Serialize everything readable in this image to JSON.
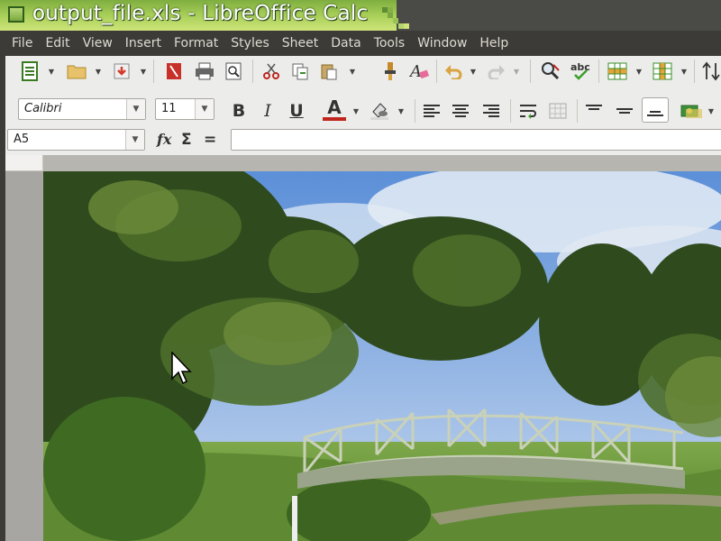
{
  "window": {
    "title": "output_file.xls - LibreOffice Calc"
  },
  "menubar": [
    "File",
    "Edit",
    "View",
    "Insert",
    "Format",
    "Styles",
    "Sheet",
    "Data",
    "Tools",
    "Window",
    "Help"
  ],
  "toolbar_standard": {
    "icons": [
      "new-document-icon",
      "open-folder-icon",
      "save-icon",
      "export-pdf-icon",
      "print-icon",
      "print-preview-icon",
      "cut-icon",
      "copy-icon",
      "paste-icon",
      "clone-formatting-icon",
      "clear-formatting-icon",
      "undo-icon",
      "redo-icon",
      "find-replace-icon",
      "spellcheck-icon",
      "row-icon",
      "column-icon",
      "sort-icon"
    ]
  },
  "toolbar_formatting": {
    "font_name": "Calibri",
    "font_size": "11",
    "bold": "B",
    "italic": "I",
    "underline": "U",
    "font_color_letter": "A"
  },
  "formula_bar": {
    "name_box": "A5",
    "fx": "fx",
    "sigma": "Σ",
    "equals": "=",
    "content": ""
  },
  "colors": {
    "menubar_bg": "#3c3b37",
    "toolbar_bg": "#ececea",
    "titlebar_green": "#9fc24a",
    "font_color_red": "#c0251e"
  }
}
